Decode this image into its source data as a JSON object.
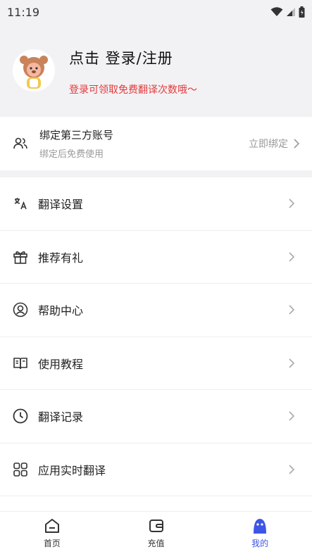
{
  "status": {
    "time": "11:19"
  },
  "profile": {
    "title": "点击 登录/注册",
    "subtitle": "登录可领取免费翻译次数哦～"
  },
  "bind": {
    "title": "绑定第三方账号",
    "subtitle": "绑定后免费使用",
    "action": "立即绑定"
  },
  "menu": {
    "items": [
      {
        "label": "翻译设置",
        "icon": "translate-settings-icon"
      },
      {
        "label": "推荐有礼",
        "icon": "gift-icon"
      },
      {
        "label": "帮助中心",
        "icon": "help-center-icon"
      },
      {
        "label": "使用教程",
        "icon": "tutorial-book-icon"
      },
      {
        "label": "翻译记录",
        "icon": "history-clock-icon"
      },
      {
        "label": "应用实时翻译",
        "icon": "apps-grid-icon"
      }
    ]
  },
  "tabs": [
    {
      "label": "首页",
      "icon": "home-icon"
    },
    {
      "label": "充值",
      "icon": "wallet-icon"
    },
    {
      "label": "我的",
      "icon": "profile-icon",
      "active": true
    }
  ],
  "colors": {
    "accent": "#3d55e6",
    "promo": "#e4393c"
  }
}
